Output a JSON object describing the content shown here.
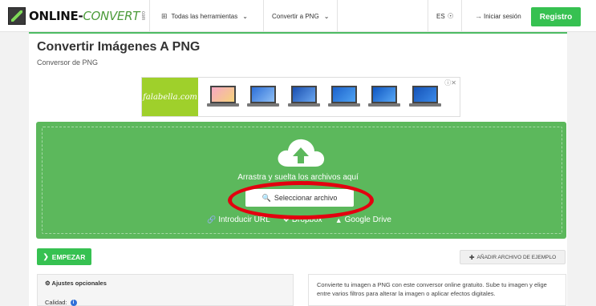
{
  "header": {
    "logo_main": "ONLINE-",
    "logo_accent": "CONVERT",
    "logo_com": "com",
    "tools_label": "Todas las herramientas",
    "convert_label": "Convertir a PNG",
    "language": "ES",
    "login_label": "Iniciar sesión",
    "register_label": "Registro"
  },
  "page": {
    "title": "Convertir Imágenes A PNG",
    "subtitle": "Conversor de PNG"
  },
  "ad": {
    "brand": "falabella.com"
  },
  "upload": {
    "drag_text": "Arrastra y suelta los archivos aquí",
    "select_label": "Seleccionar archivo",
    "url_label": "Introducir URL",
    "dropbox_label": "Dropbox",
    "drive_label": "Google Drive"
  },
  "actions": {
    "start_label": "EMPEZAR",
    "sample_label": "AÑADIR ARCHIVO DE EJEMPLO"
  },
  "options": {
    "heading": "Ajustes opcionales",
    "quality_label": "Calidad:"
  },
  "description": {
    "text": "Convierte tu imagen a PNG con este conversor online gratuito. Sube tu imagen y elige entre varios filtros para alterar la imagen o aplicar efectos digitales."
  },
  "colors": {
    "brand_green": "#36c151",
    "upload_green": "#5cb85c",
    "annotation_red": "#e3000f"
  }
}
